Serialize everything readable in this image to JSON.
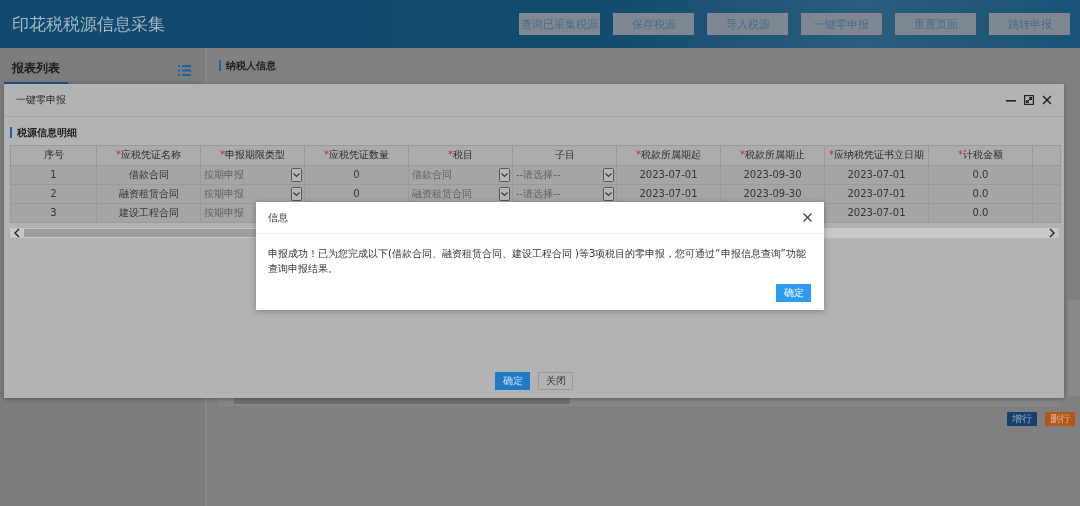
{
  "header": {
    "title": "印花税税源信息采集",
    "buttons": [
      "查询已采集税源",
      "保存税源",
      "导入税源",
      "一键零申报",
      "重置页面",
      "跳转申报"
    ]
  },
  "sidebar": {
    "title": "报表列表"
  },
  "main": {
    "section_title": "纳税人信息",
    "row_buttons": [
      {
        "label": "增行",
        "kind": "add"
      },
      {
        "label": "删行",
        "kind": "delete"
      }
    ]
  },
  "dialog": {
    "title": "一键零申报",
    "section_title": "税源信息明细",
    "table": {
      "columns": [
        {
          "label": "序号",
          "kind": "text"
        },
        {
          "label": "应税凭证名称",
          "mark": "*",
          "kind": "text"
        },
        {
          "label": "申报期限类型",
          "mark": "*",
          "kind": "select"
        },
        {
          "label": "应税凭证数量",
          "mark": "*",
          "kind": "text"
        },
        {
          "label": "税目",
          "mark": "*",
          "kind": "select"
        },
        {
          "label": "子目",
          "kind": "select"
        },
        {
          "label": "税款所属期起",
          "mark": "*",
          "kind": "text"
        },
        {
          "label": "税款所属期止",
          "mark": "*",
          "kind": "text"
        },
        {
          "label": "应纳税凭证书立日期",
          "mark": "*",
          "kind": "text"
        },
        {
          "label": "计税金额",
          "mark": "*",
          "kind": "text"
        }
      ],
      "rows": [
        {
          "cells": [
            "1",
            "借款合同",
            "按期申报",
            "0",
            "借款合同",
            "--请选择--",
            "2023-07-01",
            "2023-09-30",
            "2023-07-01",
            "0.0"
          ]
        },
        {
          "cells": [
            "2",
            "融资租赁合同",
            "按期申报",
            "0",
            "融资租赁合同",
            "--请选择--",
            "2023-07-01",
            "2023-09-30",
            "2023-07-01",
            "0.0"
          ]
        },
        {
          "cells": [
            "3",
            "建设工程合同",
            "按期申报",
            null,
            null,
            null,
            null,
            null,
            "2023-07-01",
            "0.0"
          ]
        }
      ]
    },
    "buttons": [
      {
        "label": "确定",
        "kind": "primary"
      },
      {
        "label": "关闭",
        "kind": "default"
      }
    ]
  },
  "message_box": {
    "title": "信息",
    "text": "申报成功！已为您完成以下(借款合同、融资租赁合同、建设工程合同 )等3项税目的零申报，您可通过“申报信息查询”功能查询申报结果。",
    "button": "确定"
  }
}
